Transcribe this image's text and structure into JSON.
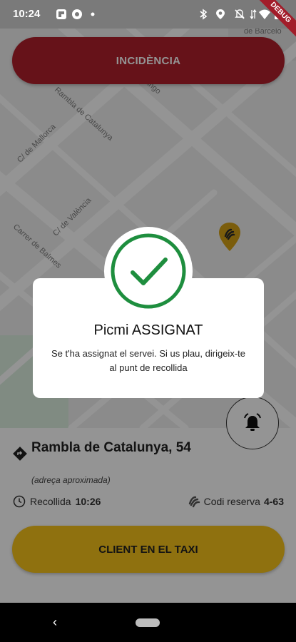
{
  "status_bar": {
    "time": "10:24",
    "icons": [
      "flipboard-icon",
      "settings-icon",
      "dot-icon",
      "bluetooth-icon",
      "location-icon",
      "mute-icon",
      "data-icon",
      "wifi-icon",
      "battery-icon"
    ]
  },
  "debug_banner": "DEBUG",
  "top_button": {
    "label": "INCIDÈNCIA"
  },
  "map": {
    "streets": [
      "C/ de Mallorca",
      "Rambla de Catalunya",
      "C/ de València",
      "Carrer de Balmes",
      "omingo",
      "de Barcelo"
    ]
  },
  "dialog": {
    "title": "Picmi ASSIGNAT",
    "message": "Se t'ha assignat el servei. Si us plau, dirigeix-te al punt de recollida"
  },
  "address": {
    "line": "Rambla de Catalunya, 54",
    "note": "(adreça aproximada)"
  },
  "pickup": {
    "label": "Recollida",
    "time": "10:26"
  },
  "reservation": {
    "label": "Codi reserva",
    "code": "4-63"
  },
  "bottom_button": {
    "label": "CLIENT EN EL TAXI"
  },
  "colors": {
    "danger": "#b01f2c",
    "primary": "#f6c31a",
    "success": "#1e8e3e"
  }
}
